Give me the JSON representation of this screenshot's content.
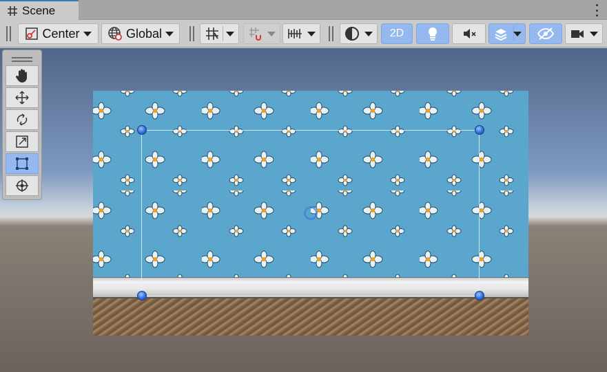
{
  "tab": {
    "title": "Scene",
    "icon": "hash-grid-icon"
  },
  "toolbar": {
    "pivot_mode": "Center",
    "pivot_space": "Global",
    "mode_2d_label": "2D",
    "accent_color": "#95b8ee"
  },
  "tools": [
    {
      "name": "hand-tool",
      "icon": "hand-icon",
      "active": false
    },
    {
      "name": "move-tool",
      "icon": "move-arrows-icon",
      "active": false
    },
    {
      "name": "rotate-tool",
      "icon": "rotate-icon",
      "active": false
    },
    {
      "name": "scale-tool",
      "icon": "scale-icon",
      "active": false
    },
    {
      "name": "rect-tool",
      "icon": "rect-transform-icon",
      "active": true
    },
    {
      "name": "transform-tool",
      "icon": "transform-icon",
      "active": false
    }
  ]
}
